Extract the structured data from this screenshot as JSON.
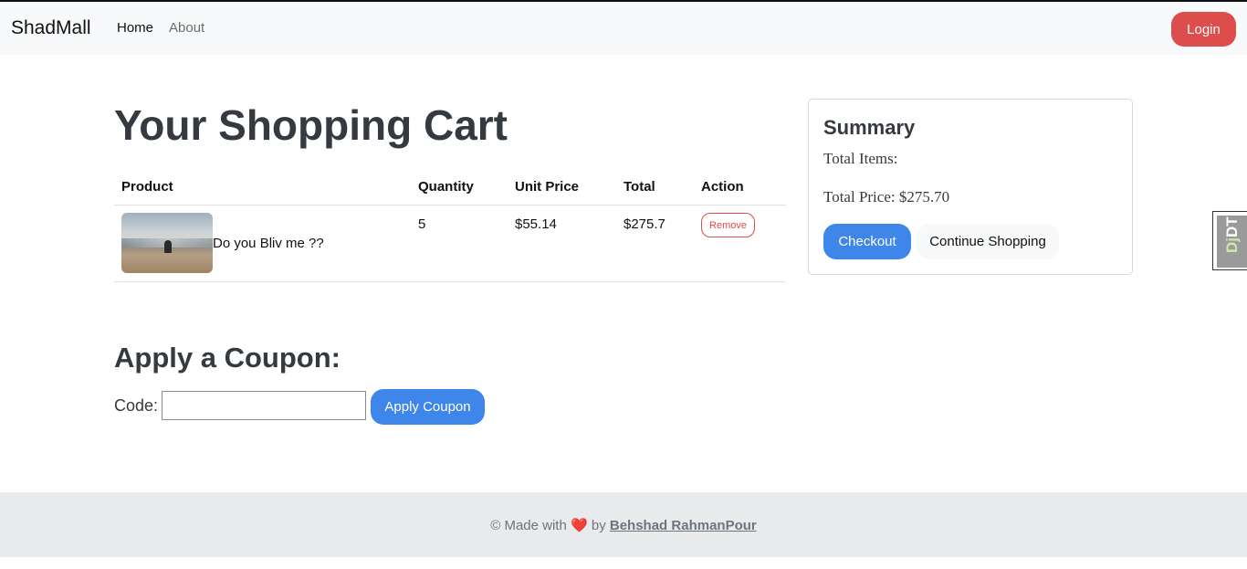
{
  "nav": {
    "brand": "ShadMall",
    "links": [
      {
        "label": "Home"
      },
      {
        "label": "About"
      }
    ],
    "login_label": "Login"
  },
  "cart": {
    "title": "Your Shopping Cart",
    "columns": [
      "Product",
      "Quantity",
      "Unit Price",
      "Total",
      "Action"
    ],
    "rows": [
      {
        "product": "Do you Bliv me ??",
        "quantity": "5",
        "unit_price": "$55.14",
        "total": "$275.7",
        "action_label": "Remove"
      }
    ]
  },
  "summary": {
    "title": "Summary",
    "total_items_label": "Total Items:",
    "total_price_label": "Total Price: $275.70",
    "checkout_label": "Checkout",
    "continue_label": "Continue Shopping"
  },
  "coupon": {
    "title": "Apply a Coupon:",
    "code_label": "Code:",
    "code_value": "",
    "apply_label": "Apply Coupon"
  },
  "side_badge": {
    "prefix": "Dj",
    "suffix": "DT"
  },
  "footer": {
    "prefix": "© Made with",
    "heart": "❤️",
    "by": "by",
    "author": "Behshad RahmanPour"
  },
  "colors": {
    "primary": "#3f86ea",
    "danger": "#dc4d4b",
    "navbar_bg": "#f8f9fa",
    "footer_bg": "#e9eaec"
  }
}
